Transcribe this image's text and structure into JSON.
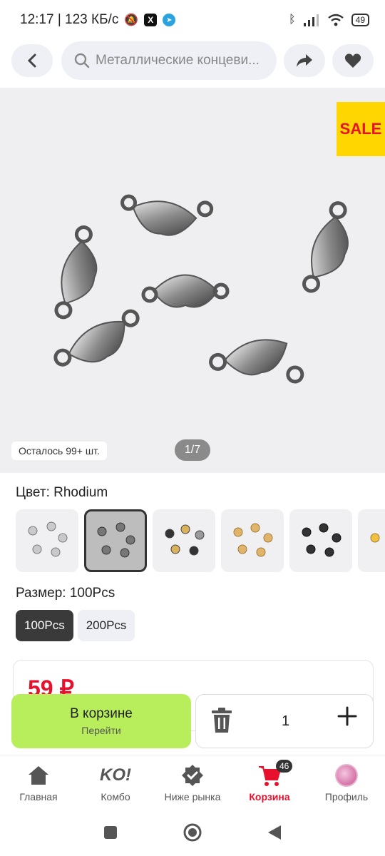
{
  "status_bar": {
    "time_speed": "12:17 | 123 КБ/с",
    "battery": "49"
  },
  "header": {
    "search_placeholder": "Металлические концеви..."
  },
  "gallery": {
    "sale_badge": "SALE",
    "stock_text": "Осталось 99+ шт.",
    "page_counter": "1/7"
  },
  "color_selector": {
    "label": "Цвет: Rhodium",
    "options": [
      "silver",
      "rhodium",
      "gold-black",
      "gold",
      "black",
      "gold-2"
    ],
    "selected_index": 1
  },
  "size_selector": {
    "label": "Размер: 100Pcs",
    "options": [
      "100Pcs",
      "200Pcs"
    ],
    "selected_index": 0
  },
  "price": {
    "value": "59 ₽"
  },
  "action_bar": {
    "cart_main": "В корзине",
    "cart_sub": "Перейти",
    "quantity": "1"
  },
  "bottom_nav": {
    "items": [
      {
        "label": "Главная",
        "icon": "home-icon"
      },
      {
        "label": "Комбо",
        "icon": "combo-logo",
        "logo_text": "KO!"
      },
      {
        "label": "Ниже рынка",
        "icon": "verified-badge-icon"
      },
      {
        "label": "Корзина",
        "icon": "cart-icon",
        "badge": "46",
        "active": true
      },
      {
        "label": "Профиль",
        "icon": "avatar"
      }
    ]
  },
  "colors": {
    "accent_red": "#e8112d",
    "cart_green": "#b8ee5c",
    "sale_yellow": "#ffd600"
  }
}
